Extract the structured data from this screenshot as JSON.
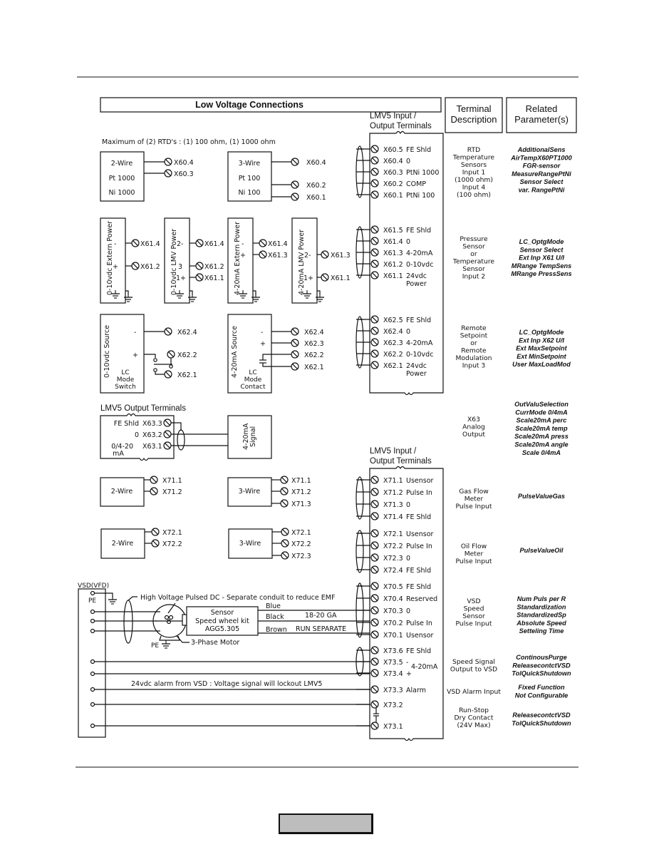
{
  "title": "Low Voltage Connections",
  "headers": {
    "lmv_io_line1": "LMV5 Input /",
    "lmv_io_line2": "Output Terminals",
    "terminal_desc_line1": "Terminal",
    "terminal_desc_line2": "Description",
    "related_params_line1": "Related",
    "related_params_line2": "Parameter(s)",
    "lmv_output_terminals": "LMV5 Output Terminals"
  },
  "rtd": {
    "note": "Maximum of (2) RTD's : (1) 100 ohm, (1) 1000 ohm",
    "two_wire": {
      "lines": [
        "2-Wire",
        "Pt 1000",
        "Ni 1000"
      ],
      "terminals": [
        "X60.4",
        "X60.3"
      ]
    },
    "three_wire": {
      "lines": [
        "3-Wire",
        "Pt 100",
        "Ni 100"
      ],
      "terminals": [
        "X60.4",
        "X60.2",
        "X60.1"
      ]
    }
  },
  "x61_devices": [
    {
      "label": "0-10vdc Extern Power",
      "pins": [
        "-",
        "+"
      ],
      "terminals": [
        "X61.4",
        "X61.2"
      ]
    },
    {
      "label": "0-10vdc LMV Power",
      "pins": [
        "2-",
        "3",
        "1+"
      ],
      "terminals": [
        "X61.4",
        "X61.2",
        "X61.1"
      ]
    },
    {
      "label": "4-20mA Extern Power",
      "pins": [
        "-",
        "+"
      ],
      "terminals": [
        "X61.4",
        "X61.3"
      ]
    },
    {
      "label": "4-20mA LMV Power",
      "pins": [
        "2-",
        "1+"
      ],
      "terminals": [
        "X61.3",
        "X61.1"
      ]
    }
  ],
  "x62_devices": [
    {
      "label": "0-10vdc Source",
      "pins": [
        "-",
        "+"
      ],
      "bottom": [
        "LC",
        "Mode",
        "Switch"
      ],
      "terminals": [
        "X62.4",
        "X62.2",
        "X62.1"
      ]
    },
    {
      "label": "4-20mA Source",
      "pins": [
        "-",
        "+"
      ],
      "bottom": [
        "LC",
        "Mode",
        "Contact"
      ],
      "terminals": [
        "X62.4",
        "X62.3",
        "X62.2",
        "X62.1"
      ]
    }
  ],
  "x63": {
    "rows": [
      {
        "label": "FE Shld",
        "terminal": "X63.3"
      },
      {
        "label": "0",
        "terminal": "X63.2"
      },
      {
        "label": "0/4-20",
        "label2": "mA",
        "terminal": "X63.1"
      }
    ],
    "signal_label1": "4-20mA",
    "signal_label2": "Signal"
  },
  "x71_devices": [
    {
      "label": "2-Wire",
      "terminals": [
        "X71.1",
        "X71.2"
      ]
    },
    {
      "label": "3-Wire",
      "terminals": [
        "X71.1",
        "X71.2",
        "X71.3"
      ]
    }
  ],
  "x72_devices": [
    {
      "label": "2-Wire",
      "terminals": [
        "X72.1",
        "X72.2"
      ]
    },
    {
      "label": "3-Wire",
      "terminals": [
        "X72.1",
        "X72.2",
        "X72.3"
      ]
    }
  ],
  "vsd": {
    "title": "VSD(VFD)",
    "pe": "PE",
    "hv_note": "High Voltage Pulsed DC - Separate conduit to reduce EMF",
    "sensor_lines": [
      "Sensor",
      "Speed wheel kit",
      "AGG5.305"
    ],
    "wire_colors": [
      "Blue",
      "Black",
      "Brown"
    ],
    "gauge": "18-20 GA",
    "run_separate": "RUN SEPARATE",
    "motor_pe": "PE",
    "motor_label": "3-Phase Motor",
    "alarm_note": "24vdc alarm from VSD : Voltage signal will lockout LMV5"
  },
  "terminal_groups": [
    {
      "rows": [
        [
          "X60.5",
          "FE Shld"
        ],
        [
          "X60.4",
          "0"
        ],
        [
          "X60.3",
          "PtNi 1000"
        ],
        [
          "X60.2",
          "COMP"
        ],
        [
          "X60.1",
          "PtNi 100"
        ]
      ],
      "description": [
        "RTD",
        "Temperature",
        "Sensors",
        "Input 1",
        "(1000 ohm)",
        "Input 4",
        "(100 ohm)"
      ],
      "params": [
        "AdditionalSens",
        "AirTempX60PT1000",
        "FGR-sensor",
        "MeasureRangePtNi",
        "Sensor Select",
        "var. RangePtNi"
      ]
    },
    {
      "rows": [
        [
          "X61.5",
          "FE Shld"
        ],
        [
          "X61.4",
          "0"
        ],
        [
          "X61.3",
          "4-20mA"
        ],
        [
          "X61.2",
          "0-10vdc"
        ],
        [
          "X61.1",
          "24vdc"
        ]
      ],
      "extra": "Power",
      "description": [
        "Pressure",
        "Sensor",
        "or",
        "Temperature",
        "Sensor",
        "Input 2"
      ],
      "params": [
        "LC_OptgMode",
        "Sensor Select",
        "Ext Inp X61 U/I",
        "MRange TempSens",
        "MRange PressSens"
      ]
    },
    {
      "rows": [
        [
          "X62.5",
          "FE Shld"
        ],
        [
          "X62.4",
          "0"
        ],
        [
          "X62.3",
          "4-20mA"
        ],
        [
          "X62.2",
          "0-10vdc"
        ],
        [
          "X62.1",
          "24vdc"
        ]
      ],
      "extra": "Power",
      "description": [
        "Remote",
        "Setpoint",
        "or",
        "Remote",
        "Modulation",
        "Input 3"
      ],
      "params": [
        "LC_OptgMode",
        "Ext Inp X62 U/I",
        "Ext MaxSetpoint",
        "Ext MinSetpoint",
        "User MaxLoadMod"
      ]
    },
    {
      "description": [
        "X63",
        "Analog",
        "Output"
      ],
      "params": [
        "OutValuSelection",
        "CurrMode 0/4mA",
        "Scale20mA perc",
        "Scale20mA temp",
        "Scale20mA press",
        "Scale20mA angle",
        "Scale 0/4mA"
      ]
    },
    {
      "rows": [
        [
          "X71.1",
          "Usensor"
        ],
        [
          "X71.2",
          "Pulse In"
        ],
        [
          "X71.3",
          "0"
        ],
        [
          "X71.4",
          "FE Shld"
        ]
      ],
      "description": [
        "Gas Flow",
        "Meter",
        "Pulse Input"
      ],
      "params": [
        "PulseValueGas"
      ]
    },
    {
      "rows": [
        [
          "X72.1",
          "Usensor"
        ],
        [
          "X72.2",
          "Pulse In"
        ],
        [
          "X72.3",
          "0"
        ],
        [
          "X72.4",
          "FE Shld"
        ]
      ],
      "description": [
        "Oil Flow",
        "Meter",
        "Pulse Input"
      ],
      "params": [
        "PulseValueOil"
      ]
    },
    {
      "rows": [
        [
          "X70.5",
          "FE Shld"
        ],
        [
          "X70.4",
          "Reserved"
        ],
        [
          "X70.3",
          "0"
        ],
        [
          "X70.2",
          "Pulse In"
        ],
        [
          "X70.1",
          "Usensor"
        ]
      ],
      "description": [
        "VSD",
        "Speed",
        "Sensor",
        "Pulse Input"
      ],
      "params": [
        "Num Puls per R",
        "Standardization",
        "StandardizedSp",
        "Absolute Speed",
        "Setteling Time"
      ]
    },
    {
      "rows": [
        [
          "X73.6",
          "FE Shld"
        ],
        [
          "X73.5",
          "-"
        ],
        [
          "X73.4",
          "+"
        ]
      ],
      "range_label": "4-20mA",
      "description": [
        "Speed Signal",
        "Output to VSD"
      ],
      "params": [
        "ContinousPurge",
        "ReleasecontctVSD",
        "TolQuickShutdown"
      ]
    },
    {
      "rows": [
        [
          "X73.3",
          "Alarm"
        ]
      ],
      "description": [
        "VSD Alarm Input"
      ],
      "params": [
        "Fixed Function",
        "Not Configurable"
      ]
    },
    {
      "rows": [
        [
          "X73.2",
          ""
        ],
        [
          "X73.1",
          ""
        ]
      ],
      "description": [
        "Run-Stop",
        "Dry Contact",
        "(24V Max)"
      ],
      "params": [
        "ReleasecontctVSD",
        "TolQuickShutdown"
      ]
    }
  ]
}
